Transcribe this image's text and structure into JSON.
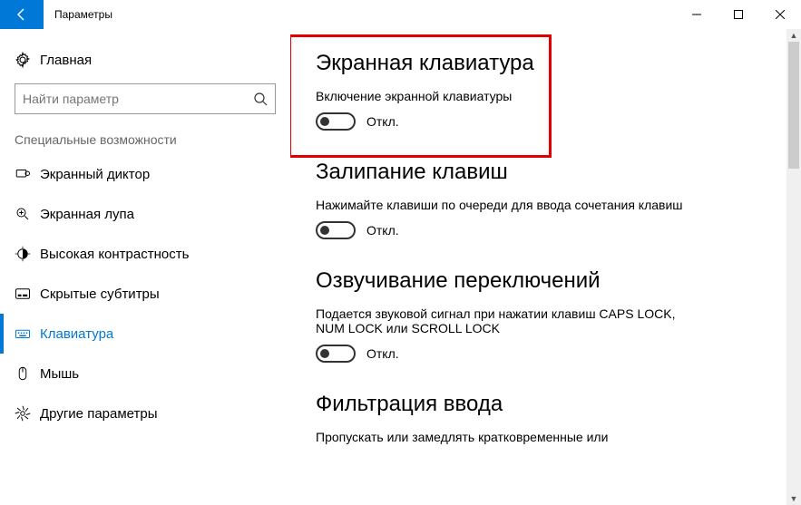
{
  "window": {
    "title": "Параметры"
  },
  "sidebar": {
    "home": "Главная",
    "search_placeholder": "Найти параметр",
    "category": "Специальные возможности",
    "items": [
      {
        "label": "Экранный диктор"
      },
      {
        "label": "Экранная лупа"
      },
      {
        "label": "Высокая контрастность"
      },
      {
        "label": "Скрытые субтитры"
      },
      {
        "label": "Клавиатура"
      },
      {
        "label": "Мышь"
      },
      {
        "label": "Другие параметры"
      }
    ]
  },
  "main": {
    "sections": [
      {
        "title": "Экранная клавиатура",
        "sub": "Включение экранной клавиатуры",
        "toggle": "Откл."
      },
      {
        "title": "Залипание клавиш",
        "sub": "Нажимайте клавиши по очереди для ввода сочетания клавиш",
        "toggle": "Откл."
      },
      {
        "title": "Озвучивание переключений",
        "sub": "Подается звуковой сигнал при нажатии клавиш CAPS LOCK, NUM LOCK или SCROLL LOCK",
        "toggle": "Откл."
      },
      {
        "title": "Фильтрация ввода",
        "sub": "Пропускать или замедлять кратковременные или"
      }
    ]
  }
}
